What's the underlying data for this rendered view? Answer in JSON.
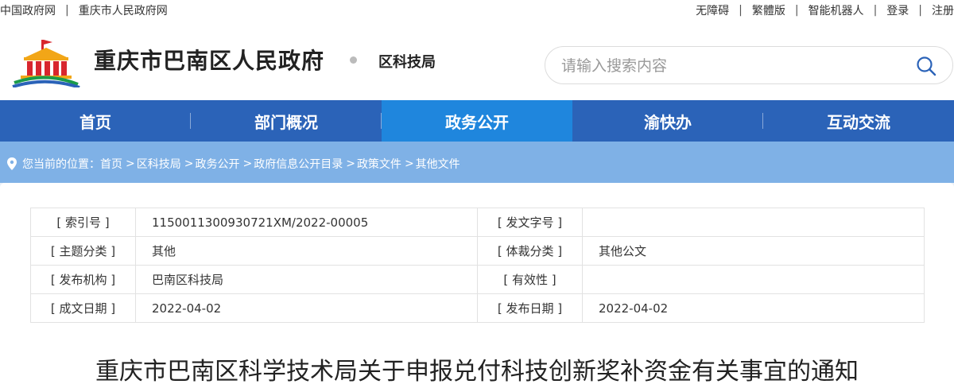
{
  "topbar": {
    "left_links": [
      "中国政府网",
      "重庆市人民政府网"
    ],
    "right_links": [
      "无障碍",
      "繁體版",
      "智能机器人",
      "登录",
      "注册"
    ]
  },
  "header": {
    "site_title": "重庆市巴南区人民政府",
    "dept_name": "区科技局",
    "logo_icon": "government-building-logo"
  },
  "search": {
    "placeholder": "请输入搜索内容",
    "icon": "search-icon"
  },
  "nav": {
    "items": [
      "首页",
      "部门概况",
      "政务公开",
      "渝快办",
      "互动交流"
    ],
    "active_index": 2,
    "color": "#2b63b8",
    "active_color": "#1f86dd"
  },
  "breadcrumb": {
    "prefix": "您当前的位置：",
    "items": [
      "首页",
      "区科技局",
      "政务公开",
      "政府信息公开目录",
      "政策文件",
      "其他文件"
    ],
    "separator": ">"
  },
  "meta": {
    "rows": [
      {
        "label1": "[ 索引号 ]",
        "value1": "115001130093072​1XM/2022-00005",
        "label2": "[ 发文字号 ]",
        "value2": ""
      },
      {
        "label1": "[ 主题分类 ]",
        "value1": "其他",
        "label2": "[ 体裁分类 ]",
        "value2": "其他公文"
      },
      {
        "label1": "[ 发布机构 ]",
        "value1": "巴南区科技局",
        "label2": "[ 有效性 ]",
        "value2": ""
      },
      {
        "label1": "[ 成文日期 ]",
        "value1": "2022-04-02",
        "label2": "[ 发布日期 ]",
        "value2": "2022-04-02"
      }
    ]
  },
  "document": {
    "title": "重庆市巴南区科学技术局关于申报兑付科技创新奖补资金有关事宜的通知"
  }
}
